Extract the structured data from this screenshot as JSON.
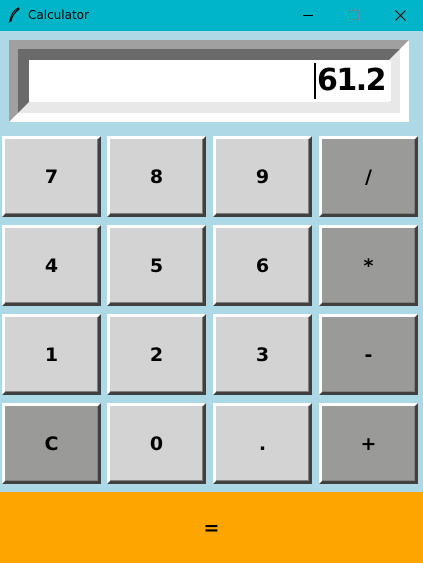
{
  "window": {
    "title": "Calculator",
    "titlebar_color": "#00B4C8",
    "icon": "feather-icon",
    "controls": [
      "minimize-icon",
      "maximize-icon",
      "close-icon"
    ]
  },
  "display": {
    "value": "61.2"
  },
  "keypad": {
    "rows": [
      [
        "7",
        "8",
        "9",
        "/"
      ],
      [
        "4",
        "5",
        "6",
        "*"
      ],
      [
        "1",
        "2",
        "3",
        "-"
      ],
      [
        "C",
        "0",
        ".",
        "+"
      ]
    ]
  },
  "equals": {
    "label": "=",
    "color": "#FFA500"
  },
  "colors": {
    "background": "#ADD8E6",
    "key_light": "#D3D3D3",
    "key_dark": "#9A9A98"
  }
}
